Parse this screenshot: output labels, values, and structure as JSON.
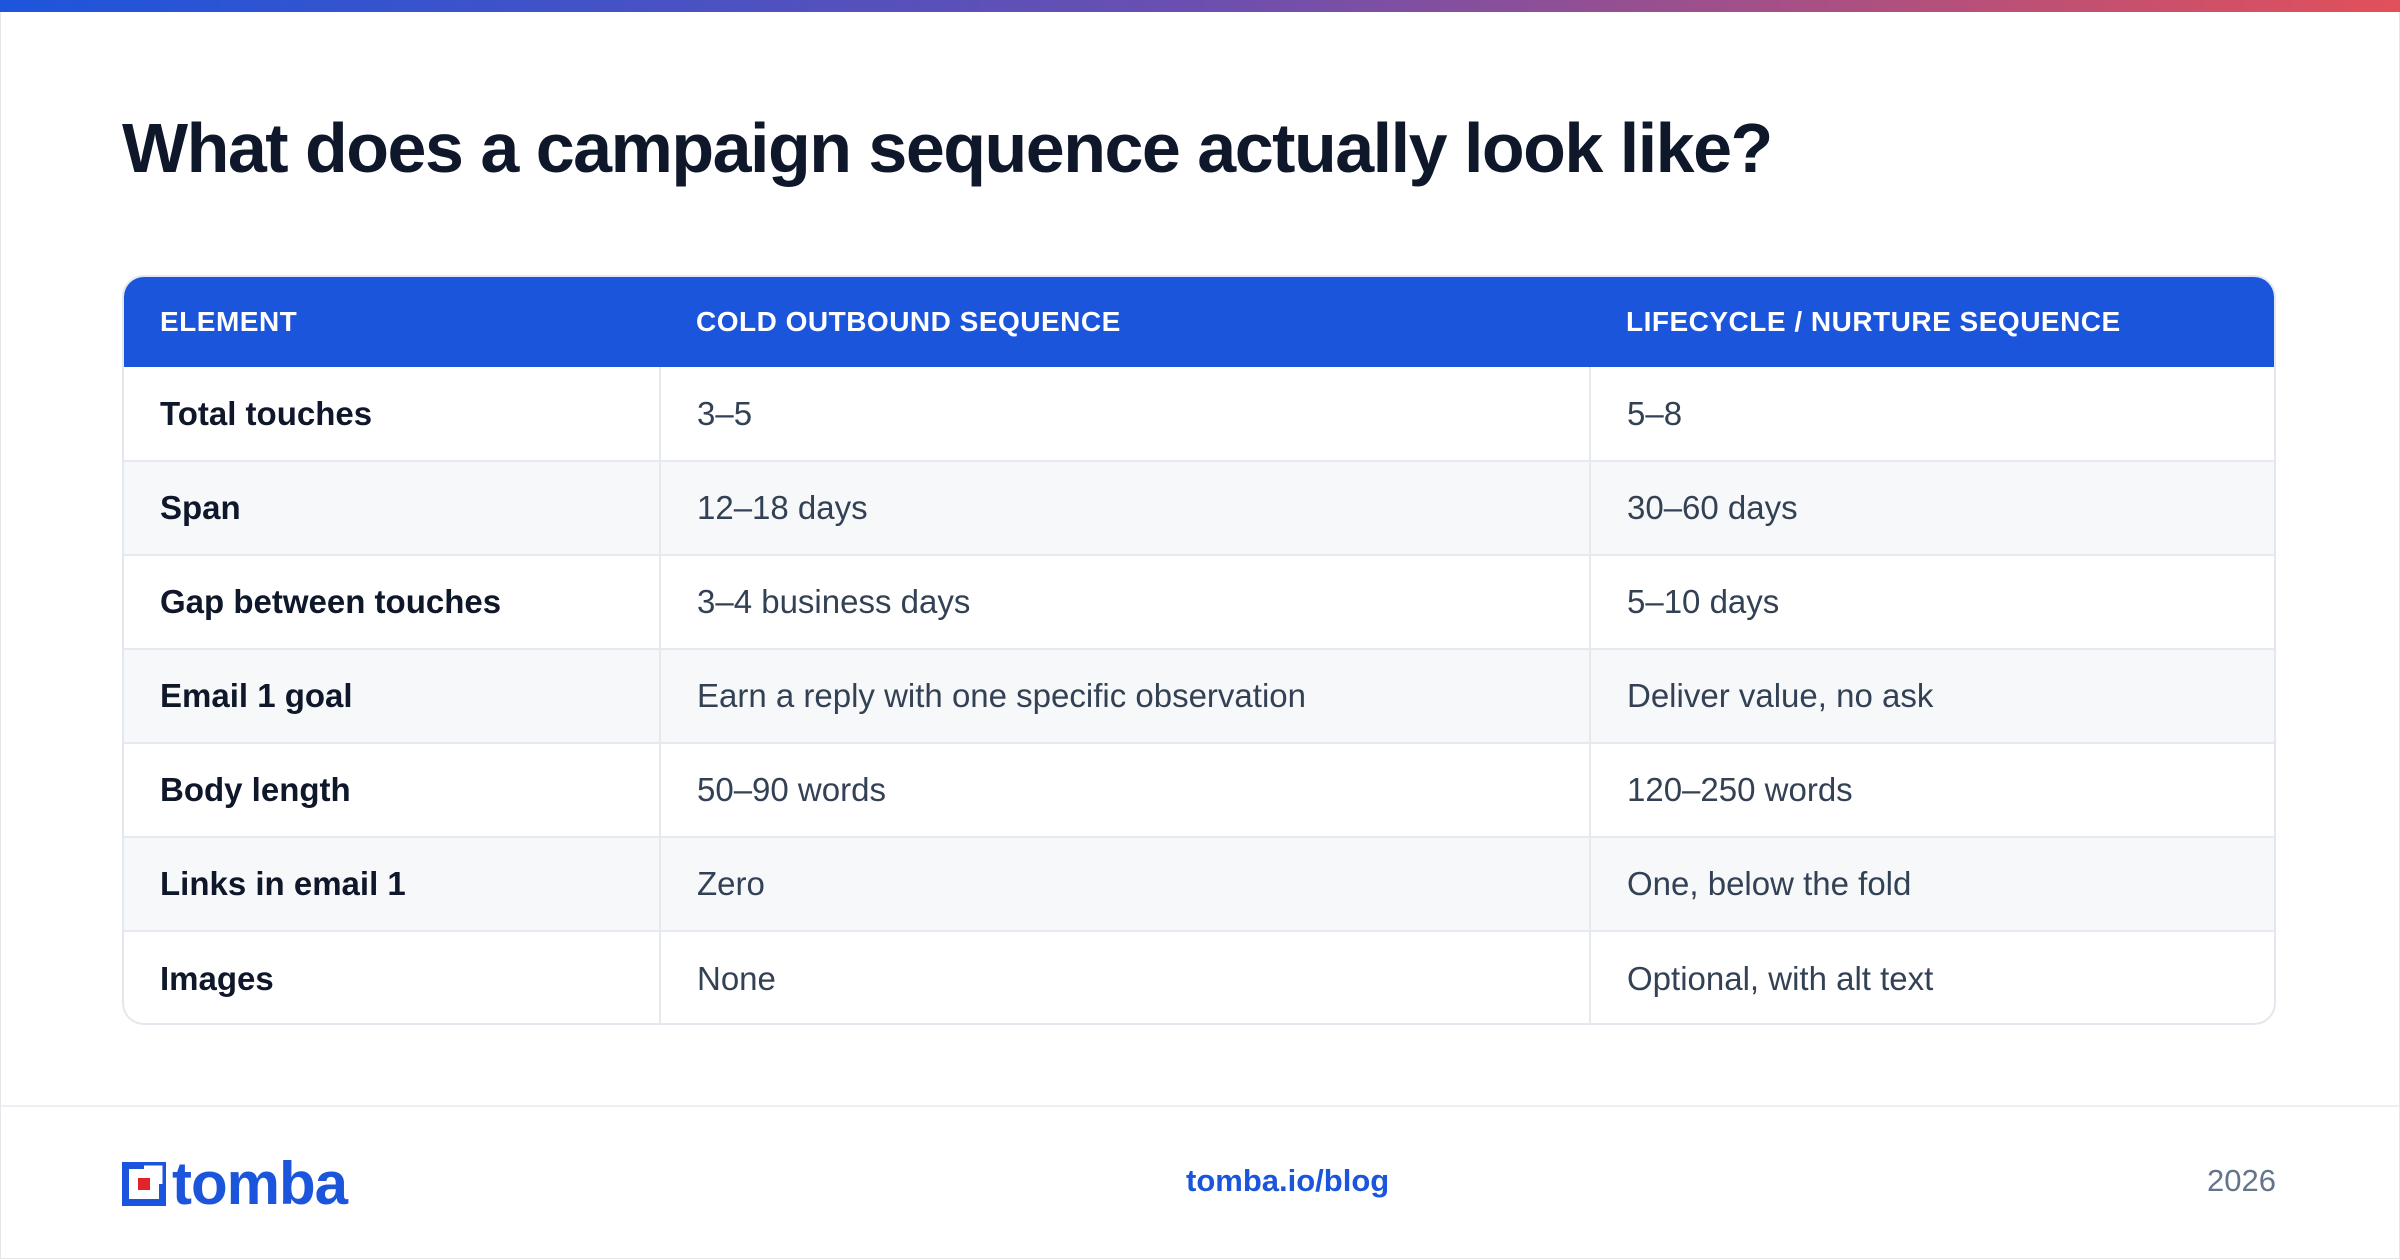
{
  "heading": "What does a campaign sequence actually look like?",
  "table": {
    "headers": [
      "ELEMENT",
      "COLD OUTBOUND SEQUENCE",
      "LIFECYCLE / NURTURE SEQUENCE"
    ],
    "rows": [
      [
        "Total touches",
        "3–5",
        "5–8"
      ],
      [
        "Span",
        "12–18 days",
        "30–60 days"
      ],
      [
        "Gap between touches",
        "3–4 business days",
        "5–10 days"
      ],
      [
        "Email 1 goal",
        "Earn a reply with one specific observation",
        "Deliver value, no ask"
      ],
      [
        "Body length",
        "50–90 words",
        "120–250 words"
      ],
      [
        "Links in email 1",
        "Zero",
        "One, below the fold"
      ],
      [
        "Images",
        "None",
        "Optional, with alt text"
      ]
    ]
  },
  "footer": {
    "brand": "tomba",
    "link": "tomba.io/blog",
    "year": "2026"
  },
  "colors": {
    "accent": "#1b55db",
    "logo_red": "#e3242b"
  },
  "icons": {
    "logo": "tomba-logo-icon"
  }
}
